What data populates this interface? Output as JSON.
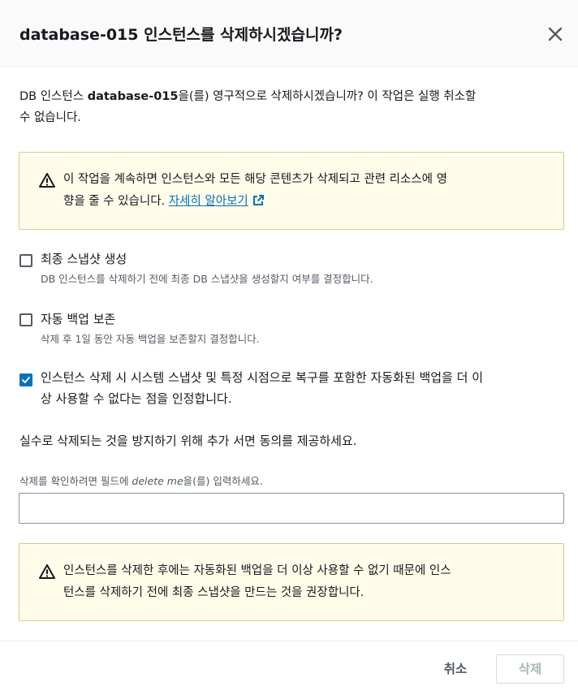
{
  "dialog": {
    "title": "database-015 인스턴스를 삭제하시겠습니까?",
    "close_icon": "close-icon"
  },
  "intro": {
    "prefix": "DB 인스턴스 ",
    "instance": "database-015",
    "line1_suffix": "을(를) 영구적으로 삭제하시겠습니까? 이 작업은 실행 취소할",
    "line2": "수 없습니다."
  },
  "warning1": {
    "icon": "warning-icon",
    "line1": "이 작업을 계속하면 인스턴스와 모든 해당 콘텐츠가 삭제되고 관련 리소스에 영",
    "line2": "향을 줄 수 있습니다. ",
    "link": "자세히 알아보기",
    "link_icon": "external-link-icon"
  },
  "options": [
    {
      "label": "최종 스냅샷 생성",
      "description": "DB 인스턴스를 삭제하기 전에 최종 DB 스냅샷을 생성할지 여부를 결정합니다.",
      "checked": false
    },
    {
      "label": "자동 백업 보존",
      "description": "삭제 후 1일 동안 자동 백업을 보존할지 결정합니다.",
      "checked": false
    },
    {
      "label_line1": "인스턴스 삭제 시 시스템 스냅샷 및 특정 시점으로 복구를 포함한 자동화된 백업을 더 이",
      "label_line2": "상 사용할 수 없다는 점을 인정합니다.",
      "checked": true
    }
  ],
  "confirm": {
    "instruction": "실수로 삭제되는 것을 방지하기 위해 추가 서면 동의를 제공하세요.",
    "field_prefix": "삭제를 확인하려면 필드에 ",
    "field_keyword": "delete me",
    "field_suffix": "을(를) 입력하세요.",
    "value": ""
  },
  "warning2": {
    "icon": "warning-icon",
    "line1": "인스턴스를 삭제한 후에는 자동화된 백업을 더 이상 사용할 수 없기 때문에 인스",
    "line2": "턴스를 삭제하기 전에 최종 스냅샷을 만드는 것을 권장합니다."
  },
  "footer": {
    "cancel_label": "취소",
    "delete_label": "삭제"
  },
  "colors": {
    "link": "#0073bb",
    "checkbox_checked": "#0073bb",
    "warning_bg": "#fffce9",
    "warning_border": "#d8c98b",
    "disabled_text": "#aab7b8"
  }
}
